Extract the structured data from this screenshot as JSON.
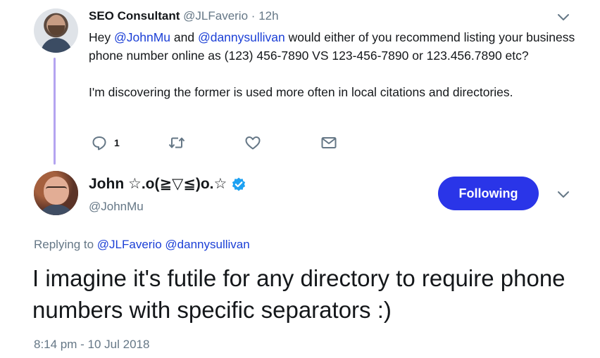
{
  "reply_tweet": {
    "author_name": "SEO Consultant",
    "author_handle": "@JLFaverio",
    "separator": "·",
    "age": "12h",
    "body_parts": {
      "greeting": "Hey ",
      "mention1": "@JohnMu",
      "and": " and ",
      "mention2": "@dannysullivan",
      "rest": " would either of you recommend listing your business phone number online as (123) 456-7890 VS 123-456-7890 or 123.456.7890 etc?"
    },
    "body_paragraph2": "I'm discovering the former is used more often in local citations and directories.",
    "reply_count": "1"
  },
  "main_tweet": {
    "author_name": "John ☆.o(≧▽≦)o.☆",
    "author_handle": "@JohnMu",
    "follow_button_label": "Following",
    "replying_to_label": "Replying to ",
    "replying_to_mention1": "@JLFaverio",
    "replying_to_mention2": "@dannysullivan",
    "text": "I imagine it's futile for any directory to require phone numbers with specific separators :)",
    "timestamp": "8:14 pm - 10 Jul 2018"
  },
  "icons": {
    "reply": "reply-icon",
    "retweet": "retweet-icon",
    "like": "heart-icon",
    "dm": "envelope-icon",
    "menu": "chevron-down-icon",
    "verified": "verified-badge-icon"
  },
  "colors": {
    "accent": "#1b3fd6",
    "follow_button": "#2a35e8",
    "thread_line": "#b4a4f0",
    "muted_text": "#657786",
    "verified": "#1da1f2"
  }
}
